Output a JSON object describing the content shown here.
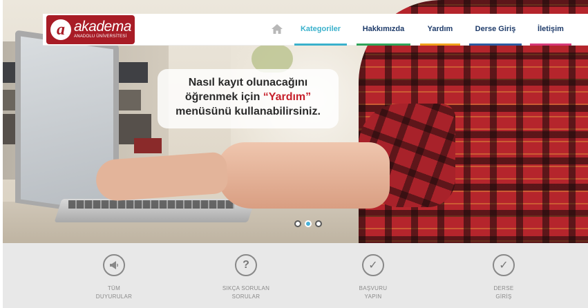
{
  "logo": {
    "mark": "a",
    "name": "akadema",
    "subtitle": "ANADOLU ÜNİVERSİTESİ"
  },
  "nav": {
    "home_icon": "home-icon",
    "items": [
      {
        "label": "Kategoriler",
        "color": "#3ab1cc",
        "active": true
      },
      {
        "label": "Hakkımızda",
        "color": "#2fa45a"
      },
      {
        "label": "Yardım",
        "color": "#f0a11c"
      },
      {
        "label": "Derse Giriş",
        "color": "#2d5aa0"
      },
      {
        "label": "İletişim",
        "color": "#d63a7a"
      }
    ]
  },
  "hero": {
    "bubble_line1": "Nasıl kayıt olunacağını",
    "bubble_line2_prefix": "öğrenmek için ",
    "bubble_line2_highlight": "“Yardım”",
    "bubble_line3": "menüsünü kullanabilirsiniz.",
    "slider": {
      "count": 3,
      "active_index": 1
    }
  },
  "features": [
    {
      "icon": "megaphone-icon",
      "glyph": "◀",
      "line1": "TÜM",
      "line2": "DUYURULAR"
    },
    {
      "icon": "question-icon",
      "glyph": "?",
      "line1": "SIKÇA SORULAN",
      "line2": "SORULAR"
    },
    {
      "icon": "checkmark-icon",
      "glyph": "✓",
      "line1": "BAŞVURU",
      "line2": "YAPIN"
    },
    {
      "icon": "checkmark-icon",
      "glyph": "✓",
      "line1": "DERSE",
      "line2": "GİRİŞ"
    }
  ],
  "colors": {
    "brand_red": "#a81c26",
    "highlight_red": "#c61f2a",
    "slider_active": "#47b1d8"
  }
}
